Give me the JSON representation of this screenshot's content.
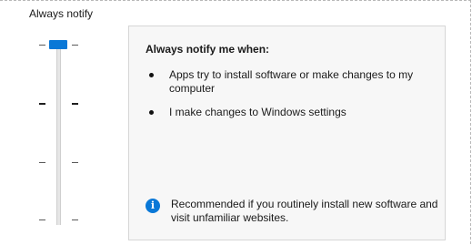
{
  "slider": {
    "top_label": "Always notify",
    "levels": 4,
    "selected_level": 4
  },
  "panel": {
    "title": "Always notify me when:",
    "bullets": [
      "Apps try to install software or make changes to my computer",
      "I make changes to Windows settings"
    ],
    "info_icon": "info-icon",
    "recommendation": "Recommended if you routinely install new software and visit unfamiliar websites."
  },
  "colors": {
    "accent": "#0a78d7",
    "panel_bg": "#f7f7f7"
  }
}
